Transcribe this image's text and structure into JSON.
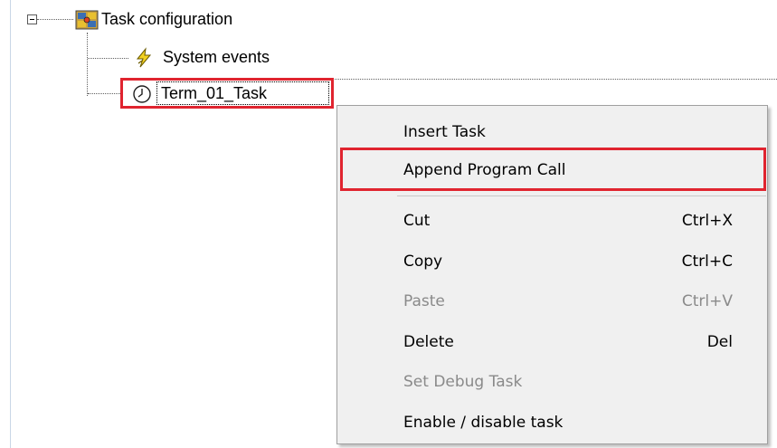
{
  "tree": {
    "root": {
      "label": "Task configuration",
      "expander": "minus",
      "icon": "task-config-icon"
    },
    "children": [
      {
        "label": "System events",
        "icon": "lightning-icon"
      },
      {
        "label": "Term_01_Task",
        "icon": "clock-icon",
        "selected": true
      }
    ]
  },
  "context_menu": {
    "items": [
      {
        "label": "Insert Task",
        "shortcut": "",
        "disabled": false
      },
      {
        "label": "Append Program Call",
        "shortcut": "",
        "disabled": false,
        "highlighted": true
      },
      {
        "label": "Cut",
        "shortcut": "Ctrl+X",
        "disabled": false
      },
      {
        "label": "Copy",
        "shortcut": "Ctrl+C",
        "disabled": false
      },
      {
        "label": "Paste",
        "shortcut": "Ctrl+V",
        "disabled": true
      },
      {
        "label": "Delete",
        "shortcut": "Del",
        "disabled": false
      },
      {
        "label": "Set Debug Task",
        "shortcut": "",
        "disabled": true
      },
      {
        "label": "Enable / disable task",
        "shortcut": "",
        "disabled": false
      }
    ]
  },
  "colors": {
    "highlight_border": "#e0242f",
    "menu_background": "#f0f0f0",
    "disabled_text": "#8a8a8a"
  }
}
